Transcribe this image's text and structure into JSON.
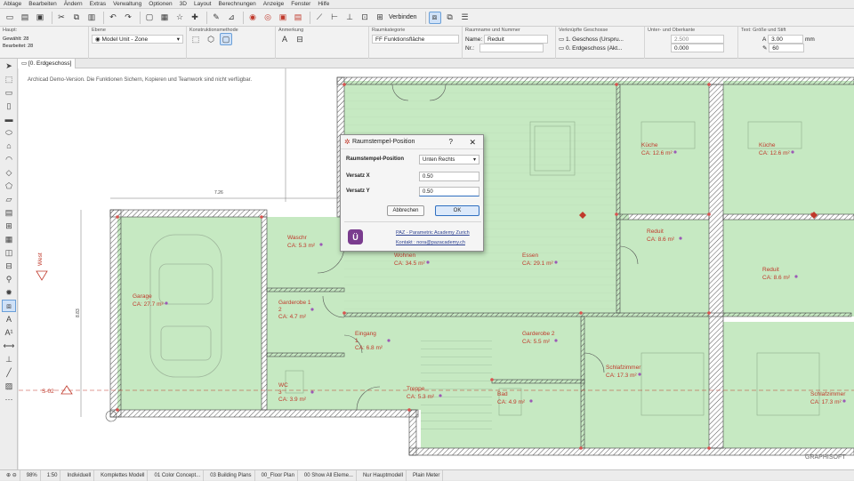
{
  "menu": [
    "Ablage",
    "Bearbeiten",
    "Ändern",
    "Extras",
    "Verwaltung",
    "Optionen",
    "3D",
    "Layout",
    "Berechnungen",
    "Anzeige",
    "Fenster",
    "Hilfe"
  ],
  "toolbar": {
    "connect_label": "Verbinden"
  },
  "infobox": {
    "main_label": "Haupt:",
    "selected": "Gewählt: 28",
    "edited": "Bearbeitet: 28",
    "layer_label": "Ebene",
    "layer_value": "Model Unit - Zone",
    "construction_label": "Konstruktionsmethode",
    "annotation_label": "Anmerkung",
    "category_label": "Raumkategorie",
    "category_value": "Funktionsfläche",
    "category_code": "FF",
    "roomname_label": "Raumname und Nummer",
    "name_label": "Name:",
    "name_value": "Reduit",
    "nr_label": "Nr.:",
    "nr_value": "",
    "story_label": "Verknüpfte Geschosse",
    "story_top": "1. Geschoss (Urspru...",
    "story_bottom": "0. Erdgeschoss (Akt...",
    "elevation_label": "Unter- und Oberkante",
    "elevation_top": "2.500",
    "elevation_bottom": "0.000",
    "text_label": "Text: Größe und Stift",
    "text_size": "3.00",
    "text_unit": "mm",
    "pen": "60"
  },
  "tab": {
    "label": "[0. Erdgeschoss]"
  },
  "demo_notice": "Archicad Demo-Version. Die Funktionen Sichern, Kopieren und Teamwork sind nicht verfügbar.",
  "plan": {
    "rooms": [
      {
        "name": "Garage",
        "area": "CA: 27.7 m²"
      },
      {
        "name": "Waschr",
        "area": "CA: 5.3 m²"
      },
      {
        "name": "Garderobe 1",
        "sub": "2",
        "area": "CA: 4.7 m²"
      },
      {
        "name": "Eingang",
        "sub": "1",
        "area": "CA: 6.8 m²"
      },
      {
        "name": "WC",
        "sub": "3",
        "area": "CA: 3.9 m²"
      },
      {
        "name": "Wohnen",
        "area": "CA: 34.5 m²"
      },
      {
        "name": "Treppe",
        "area": "CA: 5.3 m²"
      },
      {
        "name": "Essen",
        "area": "CA: 29.1 m²"
      },
      {
        "name": "Garderobe 2",
        "area": "CA: 5.5 m²"
      },
      {
        "name": "Bad",
        "area": "CA: 4.9 m²"
      },
      {
        "name": "Küche",
        "area": "CA: 12.6 m²"
      },
      {
        "name": "Reduit",
        "area": "CA: 8.6 m²"
      },
      {
        "name": "Schlafzimmer",
        "area": "CA: 17.3 m²"
      },
      {
        "name": "Küche",
        "area": "CA: 12.6 m²"
      },
      {
        "name": "Reduit",
        "area": "CA: 8.6 m²"
      },
      {
        "name": "Schlafzimmer",
        "area": "CA: 17.3 m²"
      }
    ],
    "dim_top": "7.26",
    "dim_side": "8.83",
    "west_label": "West",
    "section_label": "S-02",
    "watermark": "GRAPHISOFT"
  },
  "dialog": {
    "title": "Raumstempel-Position",
    "help": "?",
    "close": "✕",
    "pos_label": "Raumstempel-Position",
    "pos_value": "Unten Rechts",
    "x_label": "Versatz X",
    "x_value": "0.50",
    "y_label": "Versatz Y",
    "y_value": "0.50",
    "cancel": "Abbrechen",
    "ok": "OK",
    "logo": "Ü",
    "link1": "PAZ - Parametric Academy Zurich",
    "link2": "Kontakt : nora@pazacademy.ch"
  },
  "status": {
    "zoom": "98%",
    "scale": "1:50",
    "individual": "Individuell",
    "model": "Komplettes Modell",
    "concept": "01 Color Concept...",
    "plans": "03 Building Plans",
    "floorplan": "00_Floor Plan",
    "elements": "00 Show All Eleme...",
    "main_model": "Nur Hauptmodell",
    "plain": "Plain Meter"
  },
  "colors": {
    "zone_fill": "#c6e9c2",
    "wall": "#6f6f6f",
    "label": "#c0392b",
    "accent": "#2f6fc0"
  }
}
